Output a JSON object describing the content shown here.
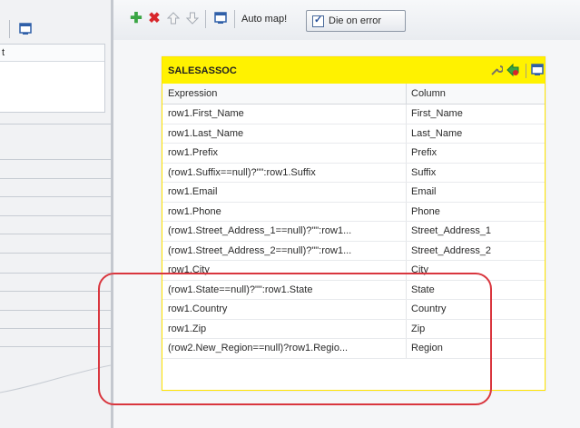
{
  "toolbar": {
    "auto_map_label": "Auto map!",
    "die_on_error_label": "Die on error",
    "die_on_error_checked": true,
    "icons": [
      "add-icon",
      "remove-icon",
      "move-up-icon",
      "move-down-icon",
      "window-icon"
    ]
  },
  "left_panel": {
    "row_text": "t",
    "icon": "window-icon"
  },
  "table": {
    "title": "SALESASSOC",
    "header_color": "#fff200",
    "columns": {
      "expression": "Expression",
      "column": "Column"
    },
    "rows": [
      {
        "expression": "row1.First_Name",
        "column": "First_Name"
      },
      {
        "expression": "row1.Last_Name",
        "column": "Last_Name"
      },
      {
        "expression": "row1.Prefix",
        "column": "Prefix"
      },
      {
        "expression": "(row1.Suffix==null)?\"\":row1.Suffix",
        "column": "Suffix"
      },
      {
        "expression": "row1.Email",
        "column": "Email"
      },
      {
        "expression": "row1.Phone",
        "column": "Phone"
      },
      {
        "expression": "(row1.Street_Address_1==null)?\"\":row1...",
        "column": "Street_Address_1"
      },
      {
        "expression": "(row1.Street_Address_2==null)?\"\":row1...",
        "column": "Street_Address_2"
      },
      {
        "expression": "row1.City",
        "column": "City"
      },
      {
        "expression": "(row1.State==null)?\"\":row1.State",
        "column": "State"
      },
      {
        "expression": "row1.Country",
        "column": "Country"
      },
      {
        "expression": "row1.Zip",
        "column": "Zip"
      },
      {
        "expression": "(row2.New_Region==null)?row1.Regio...",
        "column": "Region"
      }
    ]
  },
  "annotation_color": "#d9363e"
}
